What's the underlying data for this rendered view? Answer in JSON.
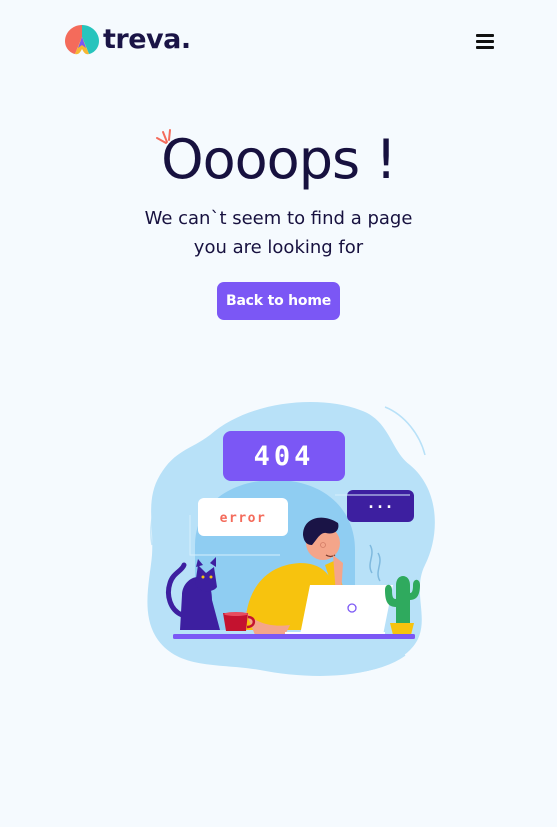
{
  "brand": {
    "name": "treva.",
    "colors": {
      "accent": "#7b57f5",
      "text": "#17113f",
      "background": "#f5fafe"
    }
  },
  "header": {
    "menu_icon": "hamburger-menu-icon"
  },
  "error_page": {
    "title": "Oooops !",
    "message": "We can`t seem to find a page you are looking for",
    "back_button_label": "Back to home"
  },
  "illustration": {
    "code_label": "404",
    "error_label": "error",
    "dots_label": "..."
  }
}
